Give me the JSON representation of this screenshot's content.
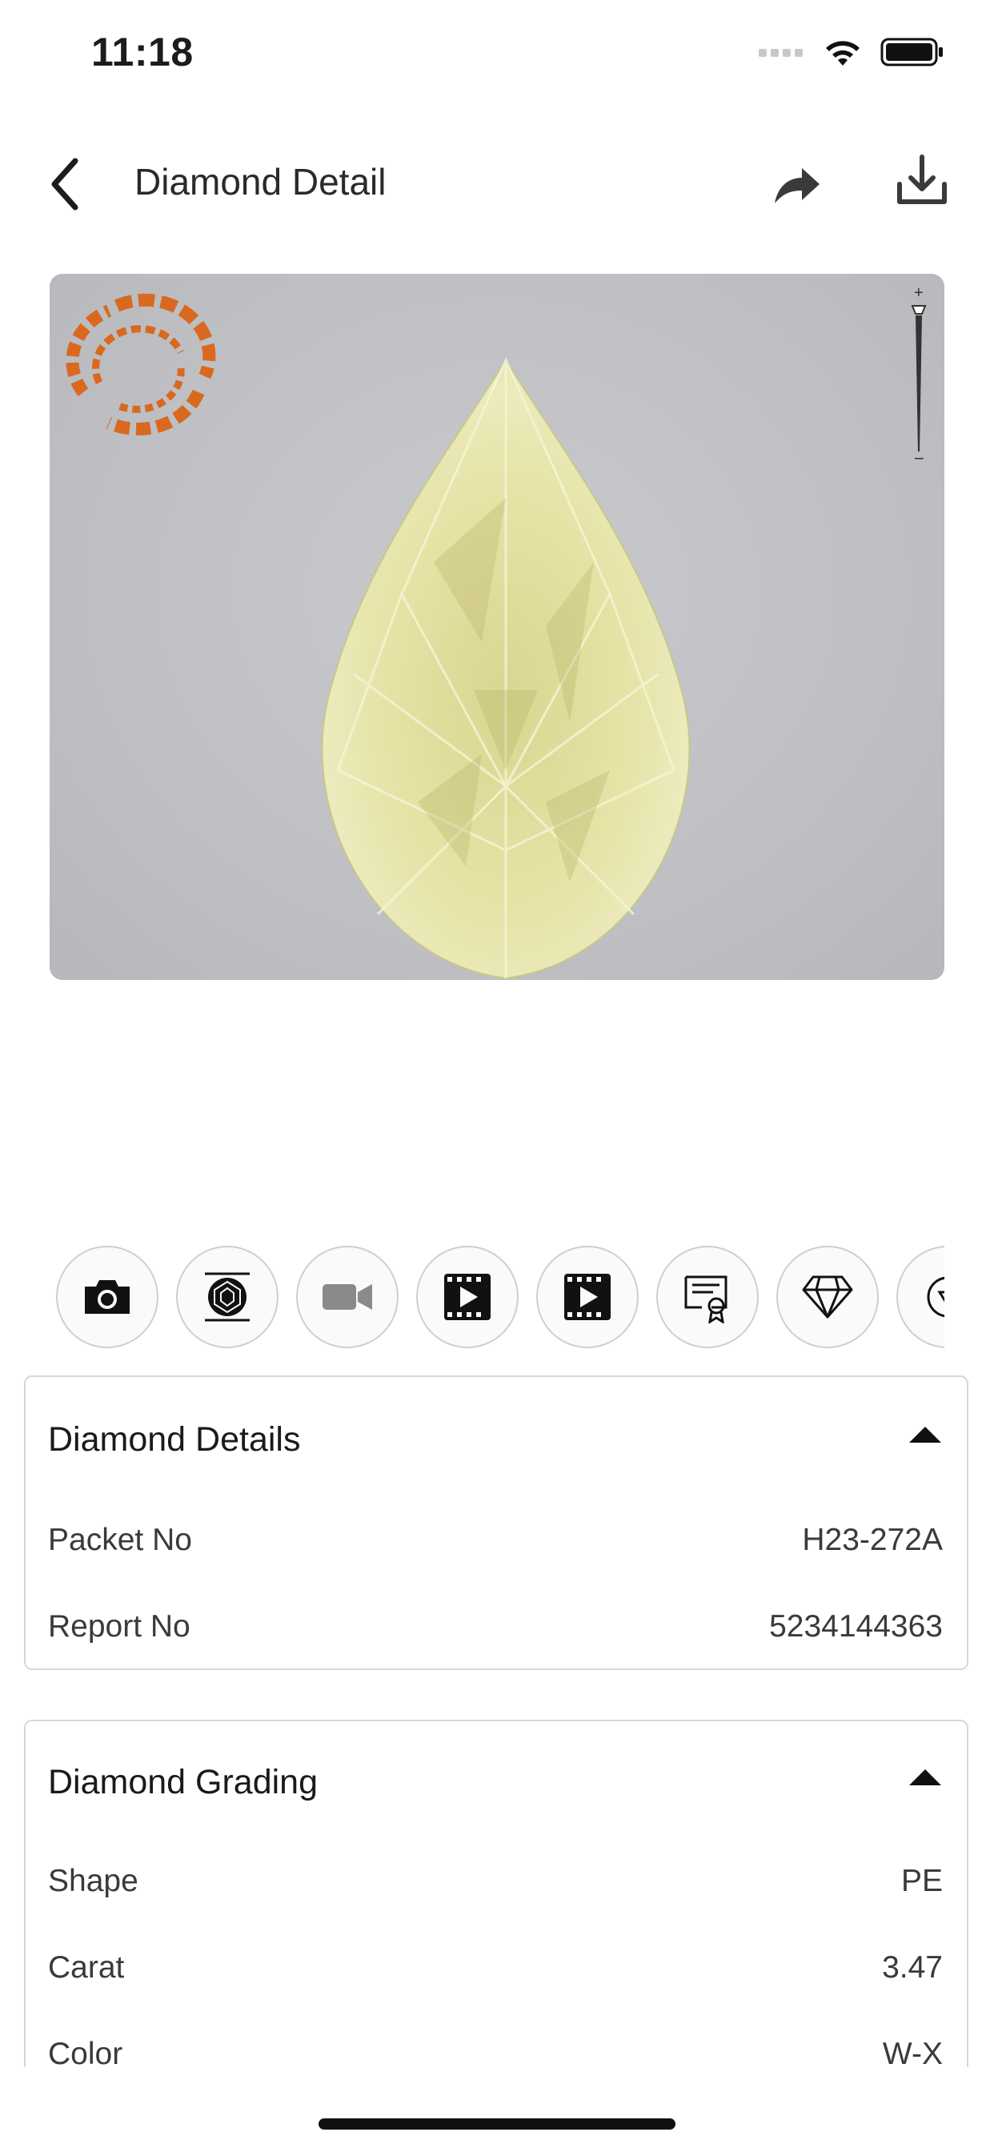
{
  "status_bar": {
    "time": "11:18"
  },
  "header": {
    "title": "Diamond Detail"
  },
  "viewer": {
    "logo": "spinner-logo",
    "zoom": {
      "plus": "+",
      "minus": "−"
    }
  },
  "media_buttons": [
    {
      "icon": "camera-icon"
    },
    {
      "icon": "diamond-top-view-icon"
    },
    {
      "icon": "video-camera-icon"
    },
    {
      "icon": "video-play-icon"
    },
    {
      "icon": "video-play-icon"
    },
    {
      "icon": "certificate-icon"
    },
    {
      "icon": "diamond-outline-icon"
    },
    {
      "icon": "gem-badge-icon"
    }
  ],
  "diamond_details": {
    "title": "Diamond Details",
    "rows": [
      {
        "label": "Packet No",
        "value": "H23-272A"
      },
      {
        "label": "Report No",
        "value": "5234144363"
      }
    ]
  },
  "diamond_grading": {
    "title": "Diamond Grading",
    "rows": [
      {
        "label": "Shape",
        "value": "PE"
      },
      {
        "label": "Carat",
        "value": "3.47"
      },
      {
        "label": "Color",
        "value": "W-X"
      }
    ]
  },
  "colors": {
    "logo_orange": "#d9691f",
    "viewer_bg": "#c0c1c4",
    "border": "#d7d7d7"
  }
}
